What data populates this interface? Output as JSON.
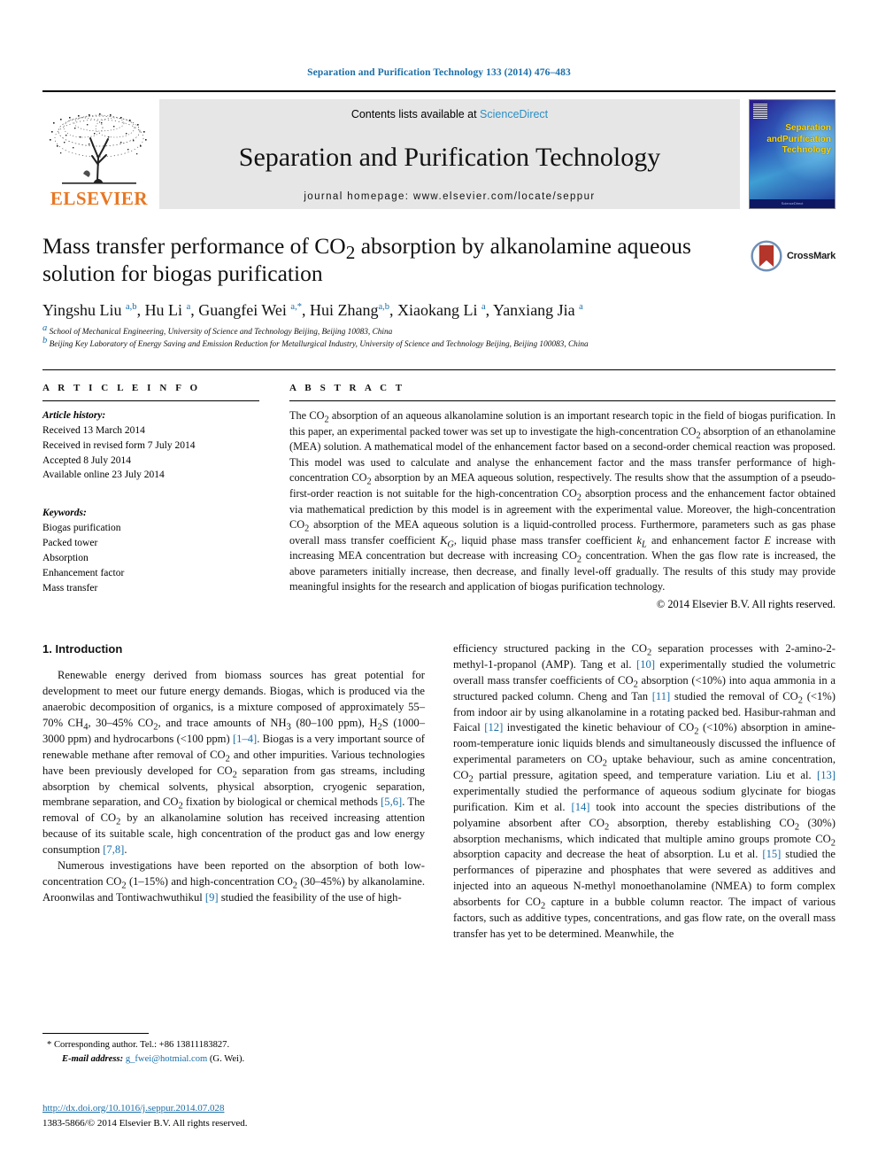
{
  "running_head": "Separation and Purification Technology 133 (2014) 476–483",
  "masthead": {
    "contents_prefix": "Contents lists available at ",
    "sciencedirect": "ScienceDirect",
    "journal_title": "Separation and Purification Technology",
    "homepage": "journal homepage: www.elsevier.com/locate/seppur",
    "publisher": "ELSEVIER",
    "cover_title_line1": "Separation",
    "cover_title_line2": "andPurification",
    "cover_title_line3": "Technology",
    "cover_footer": "ScienceDirect"
  },
  "article": {
    "title_part1": "Mass transfer performance of CO",
    "title_sub1": "2",
    "title_part2": " absorption by alkanolamine aqueous solution for biogas purification",
    "crossmark_label": "CrossMark",
    "authors": [
      {
        "name": "Yingshu Liu ",
        "sup": "a,b",
        "sep": ", "
      },
      {
        "name": "Hu Li ",
        "sup": "a",
        "sep": ", "
      },
      {
        "name": "Guangfei Wei ",
        "sup": "a,*",
        "sep": ", "
      },
      {
        "name": "Hui Zhang",
        "sup": "a,b",
        "sep": ", "
      },
      {
        "name": "Xiaokang Li ",
        "sup": "a",
        "sep": ", "
      },
      {
        "name": "Yanxiang Jia ",
        "sup": "a",
        "sep": ""
      }
    ],
    "affiliations": [
      {
        "sup": "a",
        "text": "School of Mechanical Engineering, University of Science and Technology Beijing, Beijing 10083, China"
      },
      {
        "sup": "b",
        "text": "Beijing Key Laboratory of Energy Saving and Emission Reduction for Metallurgical Industry, University of Science and Technology Beijing, Beijing 100083, China"
      }
    ]
  },
  "article_info": {
    "heading": "A R T I C L E  I N F O",
    "history_label": "Article history:",
    "history": [
      "Received 13 March 2014",
      "Received in revised form 7 July 2014",
      "Accepted 8 July 2014",
      "Available online 23 July 2014"
    ],
    "keywords_label": "Keywords:",
    "keywords": [
      "Biogas purification",
      "Packed tower",
      "Absorption",
      "Enhancement factor",
      "Mass transfer"
    ]
  },
  "abstract": {
    "heading": "A B S T R A C T",
    "copyright": "© 2014 Elsevier B.V. All rights reserved."
  },
  "sections": {
    "intro_heading": "1. Introduction"
  },
  "footnote": {
    "corresponding": "Corresponding author. Tel.: +86 13811183827.",
    "email_label": "E-mail address:",
    "email": "g_fwei@hotmial.com",
    "email_suffix": "(G. Wei)."
  },
  "doc_footer": {
    "doi": "http://dx.doi.org/10.1016/j.seppur.2014.07.028",
    "issn_line": "1383-5866/© 2014 Elsevier B.V. All rights reserved."
  },
  "colors": {
    "link": "#1a6ea8",
    "sciencedirect": "#2a8fc4",
    "elsevier_orange": "#E87722",
    "masthead_bg": "#e6e6e6"
  }
}
